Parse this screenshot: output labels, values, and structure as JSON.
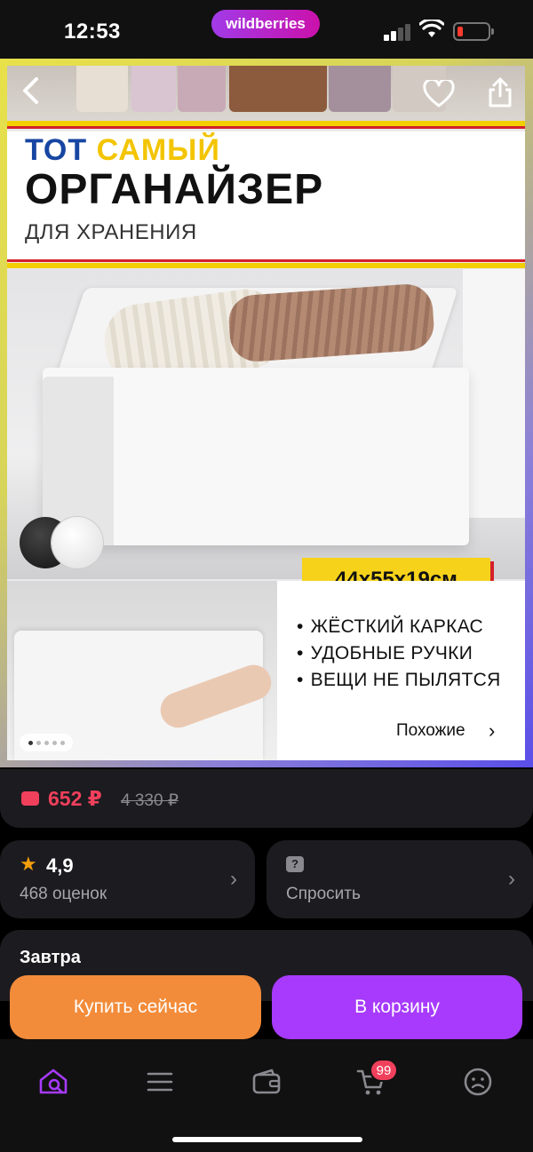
{
  "status_bar": {
    "time": "12:53",
    "brand": "wildberries"
  },
  "product_image": {
    "headline_word1": "ТОТ",
    "headline_word2": "САМЫЙ",
    "title": "ОРГАНАЙЗЕР",
    "subtitle": "ДЛЯ ХРАНЕНИЯ",
    "size": "44x55x19см",
    "features": [
      "ЖЁСТКИЙ КАРКАС",
      "УДОБНЫЕ РУЧКИ",
      "ВЕЩИ НЕ ПЫЛЯТСЯ"
    ],
    "similar_label": "Похожие",
    "pager_total": 5,
    "pager_current": 1
  },
  "price": {
    "current": "652 ₽",
    "old": "4 330 ₽"
  },
  "rating": {
    "value": "4,9",
    "count": "468 оценок"
  },
  "ask": {
    "label": "Спросить"
  },
  "delivery": {
    "label": "Завтра"
  },
  "actions": {
    "buy_now": "Купить сейчас",
    "add_to_cart": "В корзину"
  },
  "tab_bar": {
    "cart_badge": "99",
    "items": [
      "home-search-icon",
      "catalog-icon",
      "wallet-icon",
      "cart-icon",
      "profile-icon"
    ]
  },
  "colors": {
    "accent_purple": "#a73afd",
    "accent_orange": "#f28c3a",
    "price_red": "#f0405c",
    "card_bg": "#1c1b1f"
  }
}
